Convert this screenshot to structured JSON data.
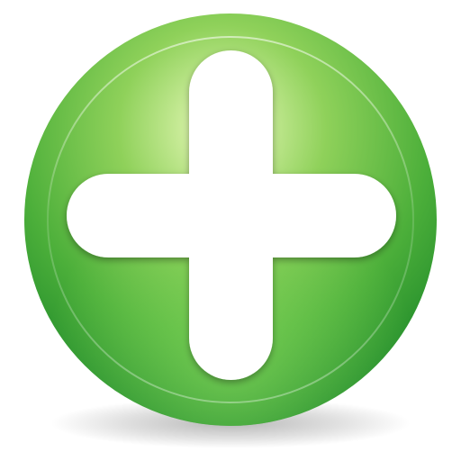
{
  "icon": {
    "name": "add-icon",
    "colors": {
      "green_dark": "#1f8a2a",
      "green_mid": "#4caf3a",
      "green_light": "#8fd15a",
      "highlight": "#eefcc0",
      "plus": "#ffffff"
    }
  }
}
